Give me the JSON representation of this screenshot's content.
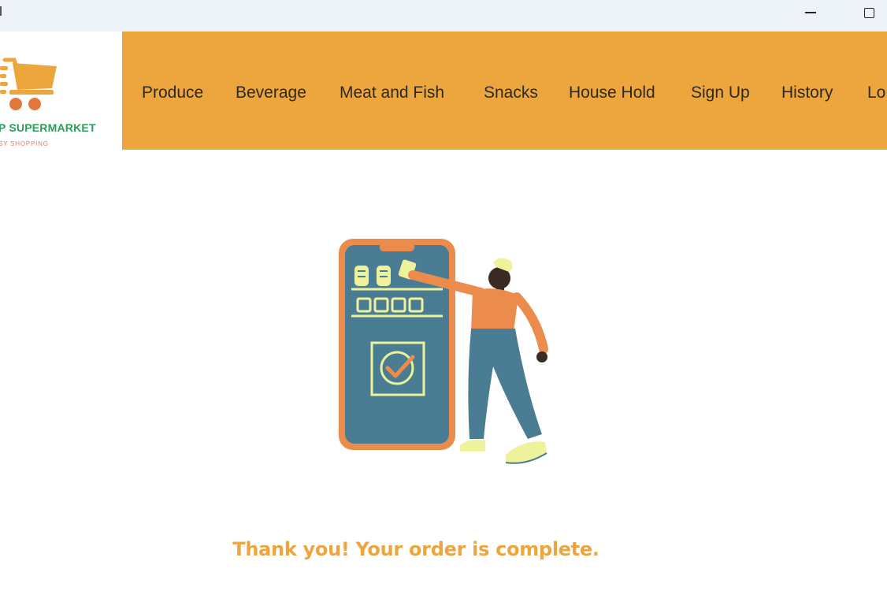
{
  "window": {
    "minimize_icon": "minimize-icon",
    "maximize_icon": "maximize-icon"
  },
  "logo": {
    "name": "P SUPERMARKET",
    "tagline": "SY SHOPPING",
    "icon": "shopping-cart-icon",
    "colors": {
      "cart": "#eca63d",
      "wheels": "#e2773e",
      "name": "#2d9b5a",
      "tagline": "#d47a7a"
    }
  },
  "nav": {
    "items": [
      {
        "label": "Produce"
      },
      {
        "label": "Beverage"
      },
      {
        "label": "Meat and Fish"
      },
      {
        "label": "Snacks"
      },
      {
        "label": "House Hold"
      },
      {
        "label": "Sign Up"
      },
      {
        "label": "History"
      },
      {
        "label": "Lo"
      }
    ],
    "background": "#eca63d"
  },
  "main": {
    "illustration": "order-complete-illustration",
    "message": "Thank you! Your order is complete.",
    "message_color": "#eca63d"
  }
}
